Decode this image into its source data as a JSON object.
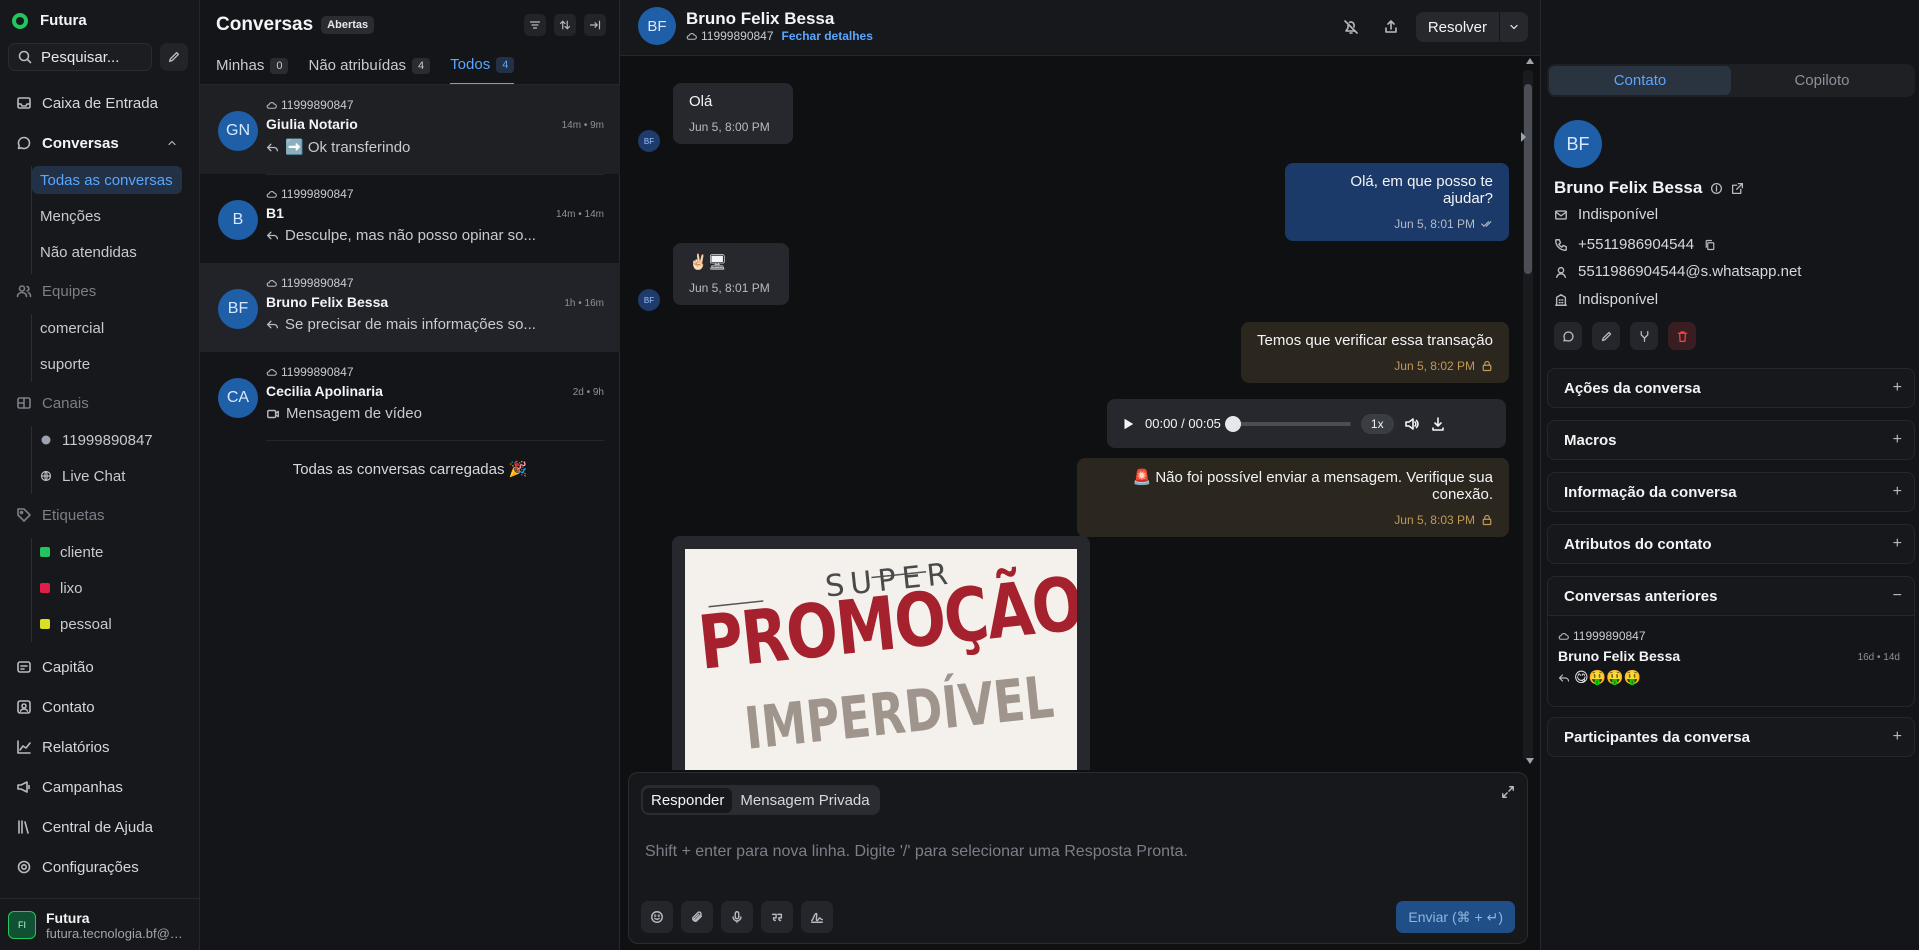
{
  "sidebar": {
    "brand": "Futura",
    "search_placeholder": "Pesquisar...",
    "nav": {
      "inbox": "Caixa de Entrada",
      "conversations": "Conversas",
      "conv_sub": [
        "Todas as conversas",
        "Menções",
        "Não atendidas"
      ],
      "teams": "Equipes",
      "teams_sub": [
        "comercial",
        "suporte"
      ],
      "channels": "Canais",
      "channels_sub": [
        "11999890847",
        "Live Chat"
      ],
      "labels": "Etiquetas",
      "labels_sub": [
        {
          "name": "cliente",
          "color": "#22c55e"
        },
        {
          "name": "lixo",
          "color": "#e11d48"
        },
        {
          "name": "pessoal",
          "color": "#d9e021"
        }
      ],
      "captain": "Capitão",
      "contact": "Contato",
      "reports": "Relatórios",
      "campaigns": "Campanhas",
      "help": "Central de Ajuda",
      "settings": "Configurações"
    },
    "user": {
      "name": "Futura",
      "email": "futura.tecnologia.bf@gmail.com"
    }
  },
  "convlist": {
    "title": "Conversas",
    "status": "Abertas",
    "tabs": [
      {
        "label": "Minhas",
        "count": "0"
      },
      {
        "label": "Não atribuídas",
        "count": "4"
      },
      {
        "label": "Todos",
        "count": "4"
      }
    ],
    "items": [
      {
        "initials": "GN",
        "inbox": "11999890847",
        "name": "Giulia Notario",
        "time": "14m • 9m",
        "message": "➡️ Ok transferindo"
      },
      {
        "initials": "B",
        "inbox": "11999890847",
        "name": "B1",
        "time": "14m • 14m",
        "message": "Desculpe, mas não posso opinar so..."
      },
      {
        "initials": "BF",
        "inbox": "11999890847",
        "name": "Bruno Felix Bessa",
        "time": "1h • 16m",
        "message": "Se precisar de mais informações so..."
      },
      {
        "initials": "CA",
        "inbox": "11999890847",
        "name": "Cecilia Apolinaria",
        "time": "2d • 9h",
        "message": "Mensagem de vídeo"
      }
    ],
    "loaded": "Todas as conversas carregadas 🎉"
  },
  "chat": {
    "contact_initials": "BF",
    "contact_name": "Bruno Felix Bessa",
    "phone": "11999890847",
    "close_details": "Fechar detalhes",
    "resolve": "Resolver",
    "messages": {
      "m1": {
        "text": "Olá",
        "time": "Jun 5, 8:00 PM"
      },
      "m2": {
        "text": "Olá, em que posso te ajudar?",
        "time": "Jun 5, 8:01 PM"
      },
      "m3": {
        "text": "✌🏻🖥",
        "time": "Jun 5, 8:01 PM"
      },
      "m4": {
        "text": "Temos que verificar essa transação",
        "time": "Jun 5, 8:02 PM"
      },
      "audio": {
        "time": "00:00 / 00:05",
        "speed": "1x",
        "progress": 0
      },
      "m5": {
        "text": "🚨 Não foi possível enviar a mensagem. Verifique sua conexão.",
        "time": "Jun 5, 8:03 PM"
      },
      "image": {
        "line1": "SUPER",
        "line2": "PROMOÇÃO",
        "line3": "IMPERDÍVEL"
      }
    },
    "composer": {
      "reply": "Responder",
      "private": "Mensagem Privada",
      "placeholder": "Shift + enter para nova linha. Digite '/' para selecionar uma Resposta Pronta.",
      "send": "Enviar (⌘ + ↵)"
    }
  },
  "rpanel": {
    "tabs": [
      "Contato",
      "Copiloto"
    ],
    "initials": "BF",
    "name": "Bruno Felix Bessa",
    "email": "Indisponível",
    "phone": "+5511986904544",
    "identifier": "5511986904544@s.whatsapp.net",
    "company": "Indisponível",
    "sections": {
      "actions": "Ações da conversa",
      "macros": "Macros",
      "info": "Informação da conversa",
      "attributes": "Atributos do contato",
      "previous": "Conversas anteriores",
      "participants": "Participantes da conversa"
    },
    "previous_item": {
      "inbox": "11999890847",
      "name": "Bruno Felix Bessa",
      "time": "16d • 14d",
      "message": "😋🤑🤑🤑"
    }
  }
}
